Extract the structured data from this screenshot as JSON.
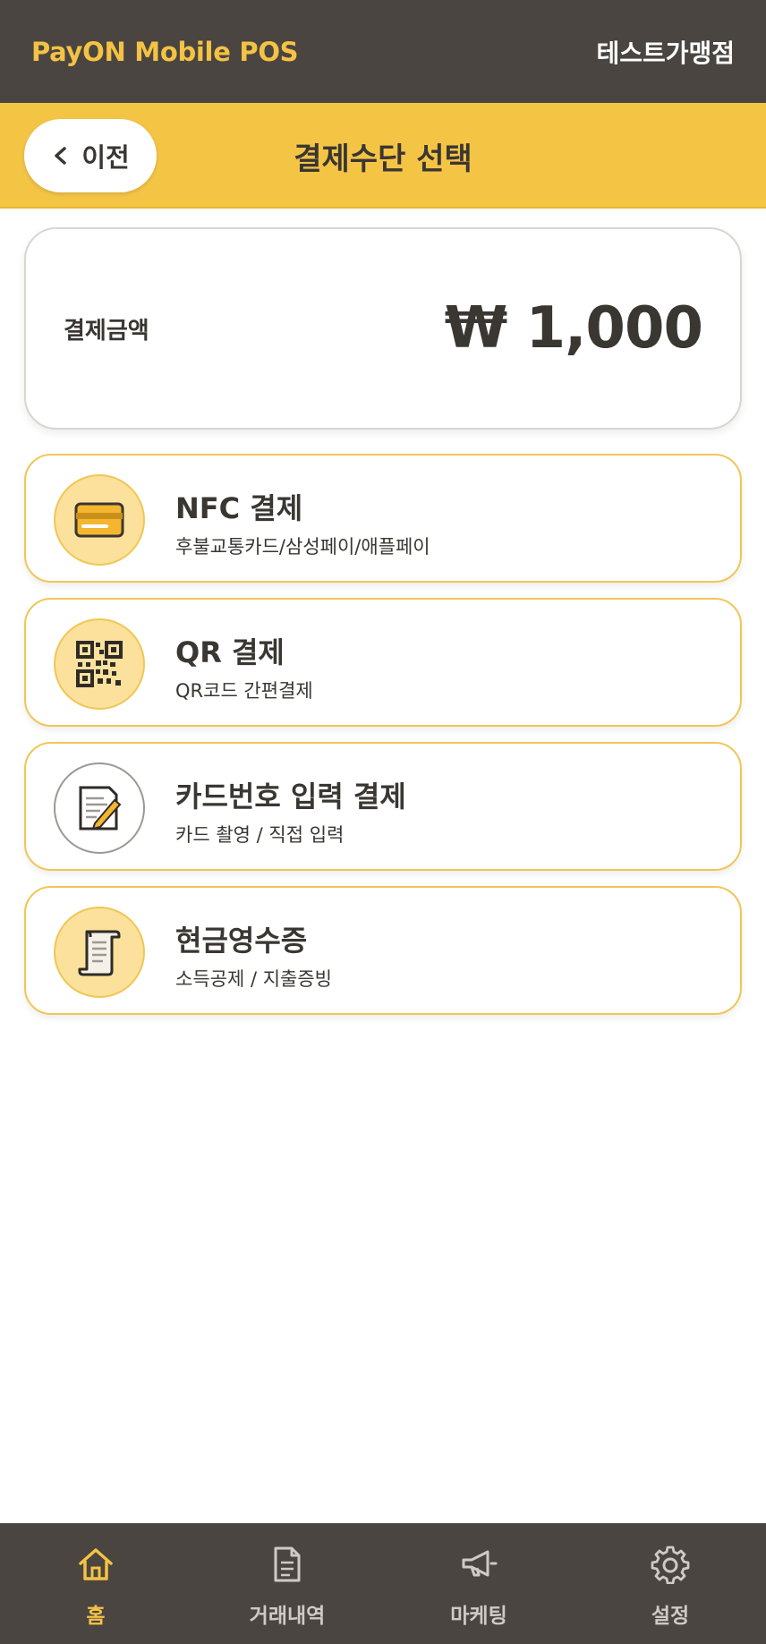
{
  "header": {
    "brand": "PayON Mobile POS",
    "store_name": "테스트가맹점"
  },
  "subheader": {
    "back_label": "이전",
    "title": "결제수단 선택"
  },
  "amount": {
    "label": "결제금액",
    "value": "₩ 1,000"
  },
  "methods": [
    {
      "title": "NFC 결제",
      "description": "후불교통카드/삼성페이/애플페이",
      "icon": "credit-card-icon"
    },
    {
      "title": "QR 결제",
      "description": "QR코드 간편결제",
      "icon": "qr-code-icon"
    },
    {
      "title": "카드번호 입력 결제",
      "description": "카드 촬영 / 직접 입력",
      "icon": "document-pen-icon"
    },
    {
      "title": "현금영수증",
      "description": "소득공제 / 지출증빙",
      "icon": "receipt-icon"
    }
  ],
  "tabbar": {
    "items": [
      {
        "label": "홈",
        "icon": "home-icon",
        "active": true
      },
      {
        "label": "거래내역",
        "icon": "document-icon",
        "active": false
      },
      {
        "label": "마케팅",
        "icon": "megaphone-icon",
        "active": false
      },
      {
        "label": "설정",
        "icon": "gear-icon",
        "active": false
      }
    ]
  },
  "colors": {
    "dark": "#4a4541",
    "accent": "#f4c244",
    "text": "#3a3632"
  }
}
